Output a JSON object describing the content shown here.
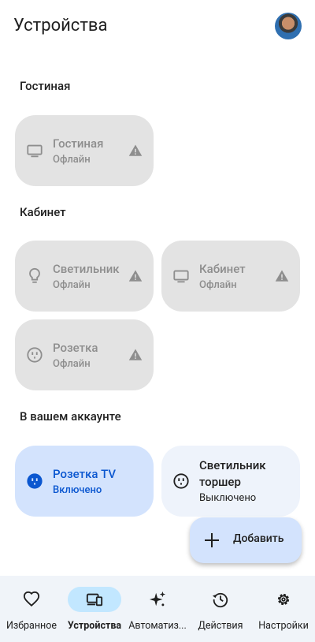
{
  "header": {
    "title": "Устройства"
  },
  "sections": {
    "living": "Гостиная",
    "office": "Кабинет",
    "account": "В вашем аккаунте"
  },
  "devices": {
    "living_tv": {
      "name": "Гостиная",
      "status": "Офлайн",
      "icon": "tv-icon"
    },
    "office_lamp": {
      "name": "Светильник",
      "status": "Офлайн",
      "icon": "lamp-icon"
    },
    "office_tv": {
      "name": "Кабинет",
      "status": "Офлайн",
      "icon": "tv-icon"
    },
    "office_outlet": {
      "name": "Розетка",
      "status": "Офлайн",
      "icon": "outlet-icon"
    },
    "acct_outlet_tv": {
      "name": "Розетка TV",
      "status": "Включено",
      "icon": "outlet-icon"
    },
    "acct_floor_lamp": {
      "name_line1": "Светильник",
      "name_line2": "торшер",
      "status": "Выключено",
      "icon": "outlet-icon"
    }
  },
  "fab": {
    "label": "Добавить"
  },
  "nav": [
    {
      "label": "Избранное",
      "icon": "heart-icon"
    },
    {
      "label": "Устройства",
      "icon": "devices-icon",
      "active": true
    },
    {
      "label": "Автоматиз...",
      "icon": "sparkle-icon"
    },
    {
      "label": "Действия",
      "icon": "history-icon"
    },
    {
      "label": "Настройки",
      "icon": "gear-icon"
    }
  ],
  "colors": {
    "offline_card": "#e3e3e3",
    "active_card": "#d3e3fd",
    "accent": "#0b57d0",
    "nav_active": "#c2e7ff"
  }
}
